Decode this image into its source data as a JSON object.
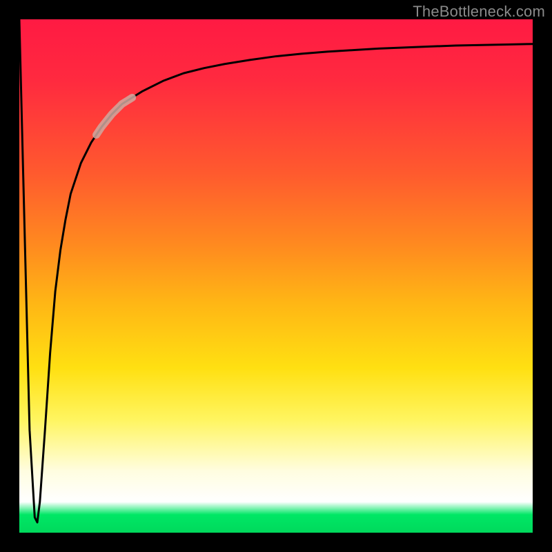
{
  "watermark": "TheBottleneck.com",
  "chart_data": {
    "type": "line",
    "title": "",
    "xlabel": "",
    "ylabel": "",
    "xlim": [
      0,
      100
    ],
    "ylim": [
      0,
      100
    ],
    "grid": false,
    "legend": false,
    "annotations": [],
    "highlight_segment": {
      "x_start": 15,
      "x_end": 22
    },
    "series": [
      {
        "name": "bottleneck-curve",
        "x": [
          0,
          1,
          2,
          3,
          3.5,
          4,
          5,
          6,
          7,
          8,
          9,
          10,
          12,
          14,
          16,
          18,
          20,
          24,
          28,
          32,
          36,
          40,
          45,
          50,
          55,
          60,
          65,
          70,
          75,
          80,
          85,
          90,
          95,
          100
        ],
        "y": [
          100,
          60,
          20,
          3,
          2,
          6,
          20,
          35,
          47,
          55,
          61,
          66,
          72,
          76,
          79,
          81.5,
          83.5,
          86,
          88,
          89.5,
          90.5,
          91.3,
          92.1,
          92.8,
          93.3,
          93.7,
          94.0,
          94.3,
          94.5,
          94.7,
          94.9,
          95.0,
          95.1,
          95.2
        ]
      }
    ],
    "gradient_stops": [
      {
        "pos": 0,
        "color": "#ff1a43"
      },
      {
        "pos": 30,
        "color": "#ff5a2e"
      },
      {
        "pos": 55,
        "color": "#ffb515"
      },
      {
        "pos": 78,
        "color": "#fff560"
      },
      {
        "pos": 94,
        "color": "#ffffff"
      },
      {
        "pos": 97,
        "color": "#00e765"
      },
      {
        "pos": 100,
        "color": "#00d95c"
      }
    ]
  }
}
